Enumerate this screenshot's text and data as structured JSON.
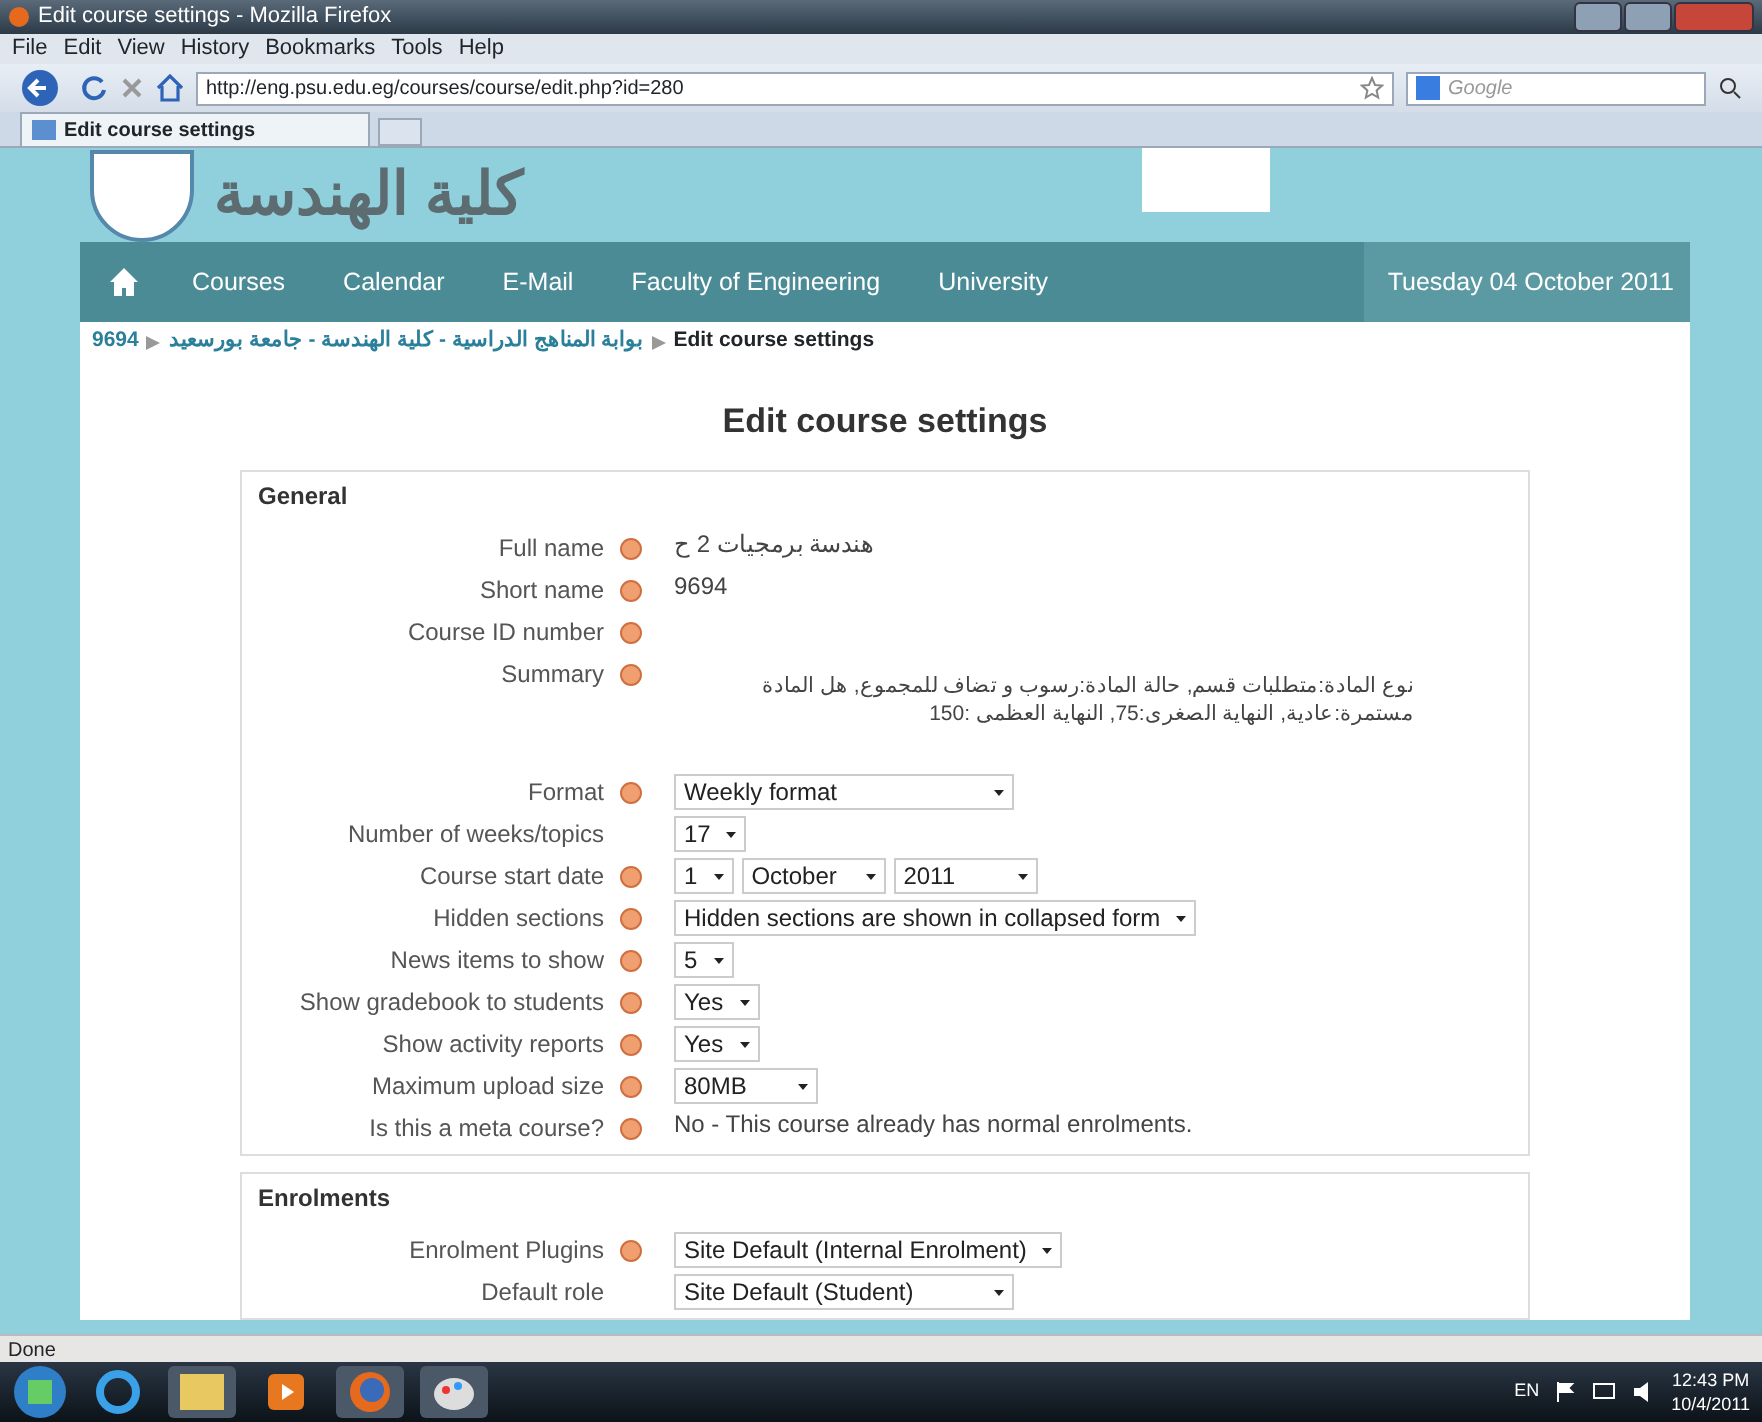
{
  "window": {
    "title": "Edit course settings - Mozilla Firefox"
  },
  "menu": [
    "File",
    "Edit",
    "View",
    "History",
    "Bookmarks",
    "Tools",
    "Help"
  ],
  "address": {
    "url": "http://eng.psu.edu.eg/courses/course/edit.php?id=280"
  },
  "search": {
    "placeholder": "Google"
  },
  "tabs": [
    {
      "label": "Edit course settings",
      "selected": true
    }
  ],
  "header": {
    "logo_text": "كلية الهندسة"
  },
  "nav": {
    "items": [
      "Courses",
      "Calendar",
      "E-Mail",
      "Faculty of Engineering",
      "University"
    ],
    "date": "Tuesday 04 October 2011"
  },
  "breadcrumb": [
    "9694",
    "بوابة المناهج الدراسية - كلية الهندسة - جامعة بورسعيد",
    "Edit course settings"
  ],
  "page_title": "Edit course settings",
  "sections": [
    {
      "legend": "General",
      "rows": [
        {
          "kind": "text",
          "label": "Full name",
          "help": true,
          "value": "هندسة برمجيات 2 ح"
        },
        {
          "kind": "text",
          "label": "Short name",
          "help": true,
          "value": "9694"
        },
        {
          "kind": "text",
          "label": "Course ID number",
          "help": true,
          "value": ""
        },
        {
          "kind": "text",
          "label": "Summary",
          "help": true,
          "value": "نوع المادة:متطلبات قسم, حالة المادة:رسوب و تضاف للمجموع, هل المادة مستمرة:عادية, النهاية الصغرى:75, النهاية العظمى :150"
        },
        {
          "kind": "select",
          "label": "Format",
          "help": true,
          "options": [
            "Weekly format"
          ]
        },
        {
          "kind": "select",
          "label": "Number of weeks/topics",
          "help": false,
          "options": [
            "17"
          ]
        },
        {
          "kind": "select",
          "label": "Course start date",
          "help": true,
          "options": [
            "1",
            "October",
            "2011"
          ]
        },
        {
          "kind": "select",
          "label": "Hidden sections",
          "help": true,
          "options": [
            "Hidden sections are shown in collapsed form"
          ]
        },
        {
          "kind": "select",
          "label": "News items to show",
          "help": true,
          "options": [
            "5"
          ]
        },
        {
          "kind": "select",
          "label": "Show gradebook to students",
          "help": true,
          "options": [
            "Yes"
          ]
        },
        {
          "kind": "select",
          "label": "Show activity reports",
          "help": true,
          "options": [
            "Yes"
          ]
        },
        {
          "kind": "select",
          "label": "Maximum upload size",
          "help": true,
          "options": [
            "80MB"
          ]
        },
        {
          "kind": "static",
          "label": "Is this a meta course?",
          "help": true,
          "value": "No - This course already has normal enrolments."
        }
      ]
    },
    {
      "legend": "Enrolments",
      "rows": [
        {
          "kind": "select",
          "label": "Enrolment Plugins",
          "help": true,
          "options": [
            "Site Default (Internal Enrolment)"
          ]
        },
        {
          "kind": "select",
          "label": "Default role",
          "help": false,
          "options": [
            "Site Default (Student)"
          ]
        }
      ]
    }
  ],
  "status_bar": "Done",
  "taskbar": {
    "language": "EN",
    "time": "12:43 PM",
    "date": "10/4/2011"
  }
}
